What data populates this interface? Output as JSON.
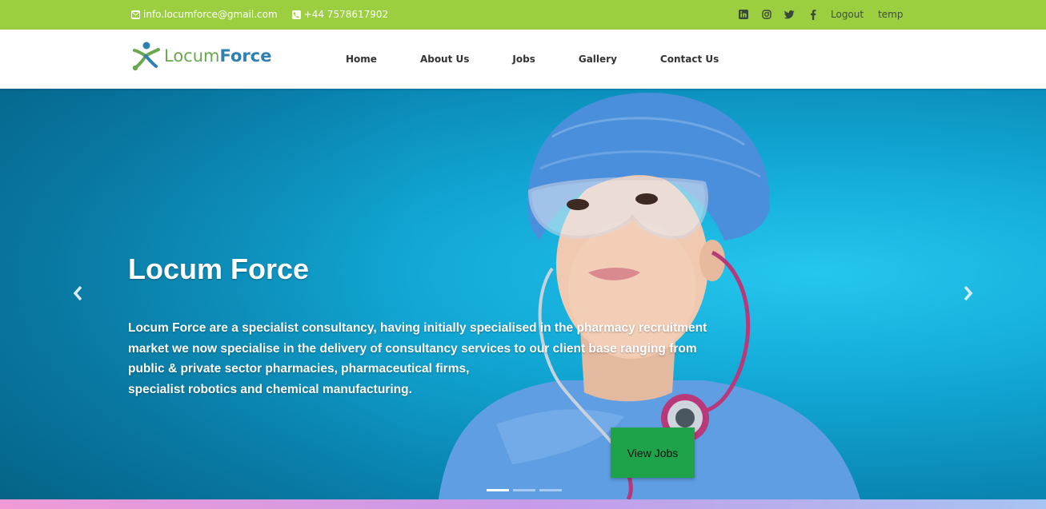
{
  "topbar": {
    "email": "info.locumforce@gmail.com",
    "phone": "+44 7578617902",
    "logout_label": "Logout",
    "user_label": "temp",
    "social": [
      "linkedin-icon",
      "instagram-icon",
      "twitter-icon",
      "facebook-icon"
    ],
    "background": "#9bcf3f"
  },
  "logo": {
    "part1": "Locum",
    "part2": "Force"
  },
  "nav": {
    "items": [
      "Home",
      "About Us",
      "Jobs",
      "Gallery",
      "Contact Us"
    ]
  },
  "hero": {
    "title": "Locum Force",
    "lines": [
      "Locum Force are a specialist consultancy, having initially specialised in the pharmacy recruitment",
      "market we now specialise in the delivery of consultancy services to our client base ranging from",
      "public & private sector pharmacies, pharmaceutical firms,",
      "specialist robotics and chemical manufacturing."
    ],
    "button_label": "View Jobs",
    "prev_icon": "chevron-left-icon",
    "next_icon": "chevron-right-icon",
    "slides": 3,
    "active_slide": 1,
    "button_color": "#1ea34a"
  }
}
